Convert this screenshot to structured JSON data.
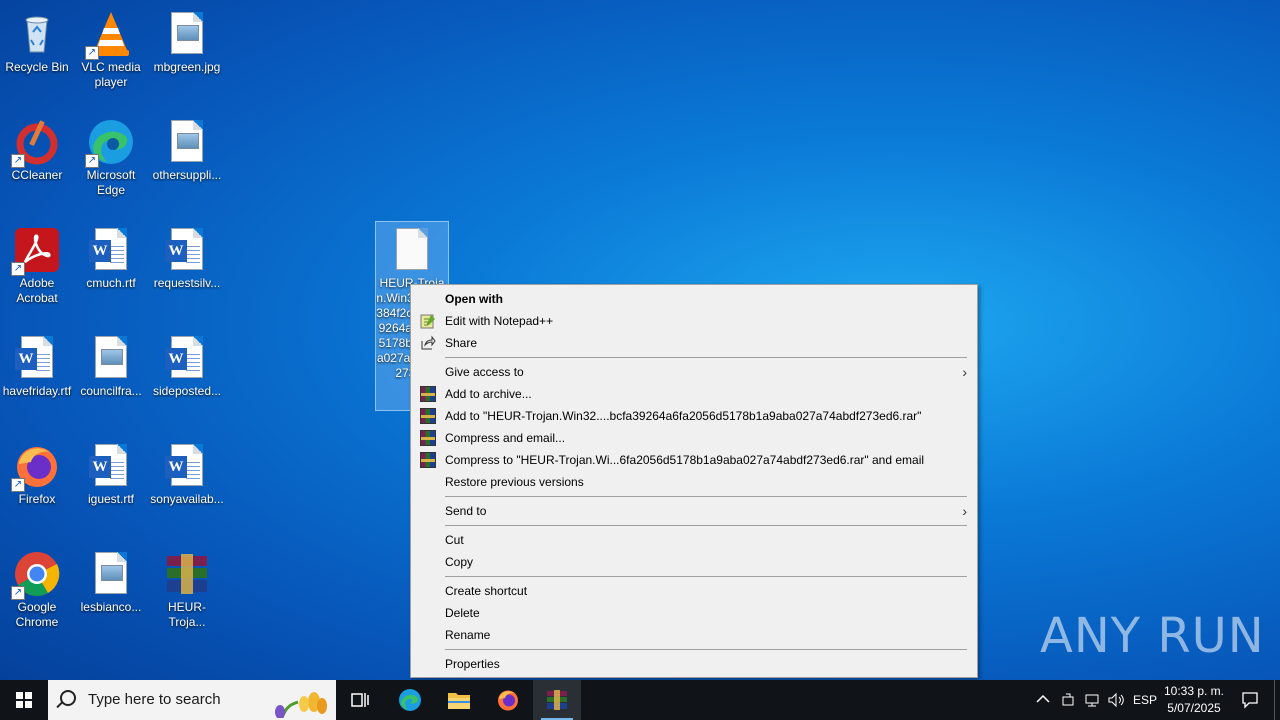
{
  "desktop": {
    "icons": [
      {
        "label": "Recycle Bin"
      },
      {
        "label": "VLC media player"
      },
      {
        "label": "mbgreen.jpg"
      },
      {
        "label": "CCleaner"
      },
      {
        "label": "Microsoft Edge"
      },
      {
        "label": "othersuppli..."
      },
      {
        "label": "Adobe Acrobat"
      },
      {
        "label": "cmuch.rtf"
      },
      {
        "label": "requestsilv..."
      },
      {
        "label": "havefriday.rtf"
      },
      {
        "label": "councilfra..."
      },
      {
        "label": "sideposted..."
      },
      {
        "label": "Firefox"
      },
      {
        "label": "iguest.rtf"
      },
      {
        "label": "sonyavailab..."
      },
      {
        "label": "Google Chrome"
      },
      {
        "label": "lesbianco..."
      },
      {
        "label": "HEUR-Troja..."
      }
    ],
    "selected_file": {
      "label": "HEUR-Trojan.Win32.gen-384f2ccbcfa39264a2056d5178b1a9aba027a74abdf273e6"
    }
  },
  "context_menu": {
    "items": [
      {
        "label": "Open with"
      },
      {
        "label": "Edit with Notepad++"
      },
      {
        "label": "Share"
      },
      {
        "label": "Give access to"
      },
      {
        "label": "Add to archive..."
      },
      {
        "label": "Add to \"HEUR-Trojan.Win32....bcfa39264a6fa2056d5178b1a9aba027a74abdf273ed6.rar\""
      },
      {
        "label": "Compress and email..."
      },
      {
        "label": "Compress to \"HEUR-Trojan.Wi...6fa2056d5178b1a9aba027a74abdf273ed6.rar\" and email"
      },
      {
        "label": "Restore previous versions"
      },
      {
        "label": "Send to"
      },
      {
        "label": "Cut"
      },
      {
        "label": "Copy"
      },
      {
        "label": "Create shortcut"
      },
      {
        "label": "Delete"
      },
      {
        "label": "Rename"
      },
      {
        "label": "Properties"
      }
    ]
  },
  "taskbar": {
    "search_placeholder": "Type here to search",
    "language": "ESP",
    "time": "10:33 p. m.",
    "date": "5/07/2025"
  },
  "watermark": "ANY RUN",
  "colors": {
    "accent": "#0a79d6",
    "taskbar": "#101418",
    "menu_bg": "#f0f0f0"
  }
}
